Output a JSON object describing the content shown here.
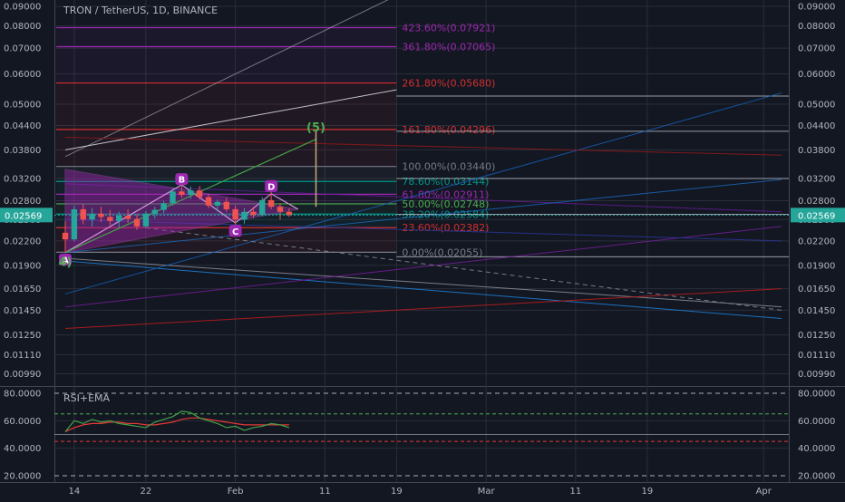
{
  "chart_data": {
    "type": "candlestick",
    "title": "TRON / TetherUS, 1D, BINANCE",
    "last_price": "0.02569",
    "y_scale": "log",
    "y_ticks": [
      "0.09000",
      "0.08000",
      "0.07000",
      "0.06000",
      "0.05000",
      "0.04400",
      "0.03800",
      "0.03200",
      "0.02800",
      "0.02500",
      "0.02200",
      "0.01900",
      "0.01650",
      "0.01450",
      "0.01250",
      "0.01110",
      "0.00990"
    ],
    "x_ticks": [
      "14",
      "22",
      "Feb",
      "11",
      "19",
      "Mar",
      "11",
      "19",
      "Apr"
    ],
    "x_range_days": [
      "2018-01-13",
      "2018-04-03"
    ],
    "fib_levels": [
      {
        "label": "423.60%(0.07921)",
        "value": 0.07921,
        "color": "#9c27b0"
      },
      {
        "label": "361.80%(0.07065)",
        "value": 0.07065,
        "color": "#9c27b0"
      },
      {
        "label": "261.80%(0.05680)",
        "value": 0.0568,
        "color": "#d32f2f"
      },
      {
        "label": "161.80%(0.04296)",
        "value": 0.04296,
        "color": "#d32f2f"
      },
      {
        "label": "100.00%(0.03440)",
        "value": 0.0344,
        "color": "#787b86"
      },
      {
        "label": "78.60%(0.03144)",
        "value": 0.03144,
        "color": "#009688"
      },
      {
        "label": "61.80%(0.02911)",
        "value": 0.02911,
        "color": "#9c27b0"
      },
      {
        "label": "50.00%(0.02748)",
        "value": 0.02748,
        "color": "#4caf50"
      },
      {
        "label": "38.20%(0.02584)",
        "value": 0.02584,
        "color": "#009688"
      },
      {
        "label": "23.60%(0.02382)",
        "value": 0.02382,
        "color": "#d32f2f"
      },
      {
        "label": "0.00%(0.02055)",
        "value": 0.02055,
        "color": "#787b86"
      }
    ],
    "wave_labels": [
      {
        "text": "A",
        "date": "2018-01-13",
        "price": 0.0196,
        "color": "#9c27b0"
      },
      {
        "text": "B",
        "date": "2018-01-26",
        "price": 0.0318,
        "color": "#9c27b0"
      },
      {
        "text": "C",
        "date": "2018-02-01",
        "price": 0.0233,
        "color": "#9c27b0"
      },
      {
        "text": "D",
        "date": "2018-02-05",
        "price": 0.0305,
        "color": "#9c27b0"
      },
      {
        "text": "(5)",
        "date": "2018-02-10",
        "price": 0.0425,
        "color": "#4caf50"
      },
      {
        "text": "4)",
        "date": "2018-01-13",
        "price": 0.0189,
        "color": "#4caf50"
      }
    ],
    "candles": [
      {
        "d": "2018-01-13",
        "o": 0.0231,
        "h": 0.0248,
        "l": 0.0205,
        "c": 0.0222
      },
      {
        "d": "2018-01-14",
        "o": 0.0222,
        "h": 0.0272,
        "l": 0.0219,
        "c": 0.0266
      },
      {
        "d": "2018-01-15",
        "o": 0.0266,
        "h": 0.0274,
        "l": 0.0243,
        "c": 0.025
      },
      {
        "d": "2018-01-16",
        "o": 0.025,
        "h": 0.0268,
        "l": 0.024,
        "c": 0.0259
      },
      {
        "d": "2018-01-17",
        "o": 0.0259,
        "h": 0.027,
        "l": 0.0246,
        "c": 0.0254
      },
      {
        "d": "2018-01-18",
        "o": 0.0254,
        "h": 0.0265,
        "l": 0.0242,
        "c": 0.0248
      },
      {
        "d": "2018-01-19",
        "o": 0.0248,
        "h": 0.0262,
        "l": 0.0238,
        "c": 0.0256
      },
      {
        "d": "2018-01-20",
        "o": 0.0256,
        "h": 0.0266,
        "l": 0.0245,
        "c": 0.0251
      },
      {
        "d": "2018-01-21",
        "o": 0.0251,
        "h": 0.0258,
        "l": 0.0235,
        "c": 0.024
      },
      {
        "d": "2018-01-22",
        "o": 0.024,
        "h": 0.0263,
        "l": 0.0238,
        "c": 0.0259
      },
      {
        "d": "2018-01-23",
        "o": 0.0259,
        "h": 0.027,
        "l": 0.0252,
        "c": 0.0265
      },
      {
        "d": "2018-01-24",
        "o": 0.0265,
        "h": 0.028,
        "l": 0.026,
        "c": 0.0276
      },
      {
        "d": "2018-01-25",
        "o": 0.0276,
        "h": 0.0302,
        "l": 0.0272,
        "c": 0.0296
      },
      {
        "d": "2018-01-26",
        "o": 0.0296,
        "h": 0.032,
        "l": 0.0285,
        "c": 0.029
      },
      {
        "d": "2018-01-27",
        "o": 0.029,
        "h": 0.0305,
        "l": 0.0283,
        "c": 0.0298
      },
      {
        "d": "2018-01-28",
        "o": 0.0298,
        "h": 0.0306,
        "l": 0.0282,
        "c": 0.0286
      },
      {
        "d": "2018-01-29",
        "o": 0.0286,
        "h": 0.0292,
        "l": 0.0268,
        "c": 0.0272
      },
      {
        "d": "2018-01-30",
        "o": 0.0272,
        "h": 0.0282,
        "l": 0.0262,
        "c": 0.0278
      },
      {
        "d": "2018-01-31",
        "o": 0.0278,
        "h": 0.0285,
        "l": 0.0262,
        "c": 0.0266
      },
      {
        "d": "2018-02-01",
        "o": 0.0266,
        "h": 0.0272,
        "l": 0.024,
        "c": 0.025
      },
      {
        "d": "2018-02-02",
        "o": 0.025,
        "h": 0.0268,
        "l": 0.0244,
        "c": 0.0262
      },
      {
        "d": "2018-02-03",
        "o": 0.0262,
        "h": 0.027,
        "l": 0.0252,
        "c": 0.0257
      },
      {
        "d": "2018-02-04",
        "o": 0.0257,
        "h": 0.0286,
        "l": 0.0255,
        "c": 0.0281
      },
      {
        "d": "2018-02-05",
        "o": 0.0281,
        "h": 0.0296,
        "l": 0.0266,
        "c": 0.027
      },
      {
        "d": "2018-02-06",
        "o": 0.027,
        "h": 0.0276,
        "l": 0.025,
        "c": 0.0262
      },
      {
        "d": "2018-02-07",
        "o": 0.0262,
        "h": 0.0268,
        "l": 0.0254,
        "c": 0.0257
      }
    ],
    "projection_line": {
      "from": {
        "date": "2018-02-10",
        "price": 0.0425
      },
      "to": {
        "date": "2018-02-10",
        "price": 0.027
      }
    },
    "rsi_panel": {
      "label": "RSI+EMA",
      "y_ticks": [
        "80.0000",
        "60.0000",
        "40.0000",
        "20.0000"
      ],
      "y_range": [
        16,
        84
      ],
      "levels": [
        {
          "value": 65,
          "color": "#4caf50"
        },
        {
          "value": 45,
          "color": "#e53935"
        }
      ],
      "rsi": [
        52,
        60,
        58,
        61,
        59,
        60,
        58,
        57,
        56,
        55,
        59,
        61,
        63,
        67,
        66,
        62,
        60,
        58,
        55,
        56,
        53,
        55,
        56,
        58,
        57,
        55
      ],
      "ema": [
        52,
        55,
        57,
        58,
        58,
        59,
        59,
        58,
        58,
        57,
        57,
        58,
        59,
        61,
        62,
        62,
        61,
        60,
        59,
        58,
        57,
        57,
        57,
        57,
        57,
        57
      ]
    },
    "colors": {
      "background": "#131722",
      "up": "#26a69a",
      "down": "#ef5350",
      "last_price_badge": "#26a69a",
      "grid": "#2a2e39",
      "text": "#b2b5be",
      "pattern": "#9c27b0"
    }
  }
}
